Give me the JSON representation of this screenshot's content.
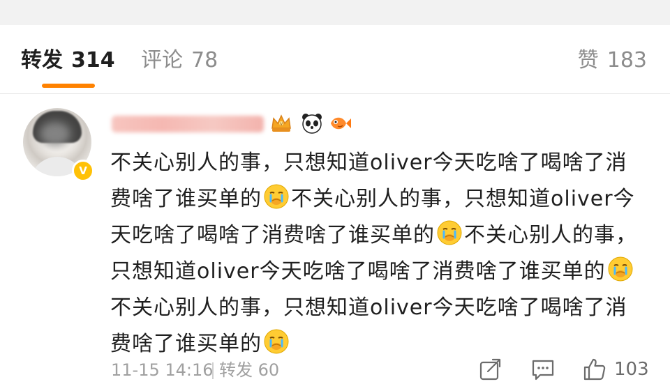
{
  "tabs": {
    "forward": {
      "label": "转发",
      "count": "314"
    },
    "comment": {
      "label": "评论",
      "count": "78"
    },
    "like": {
      "label": "赞",
      "count": "183"
    }
  },
  "comment": {
    "text_segments": [
      "不关心别人的事，只想知道oliver今天吃啥了喝啥了消费啥了谁买单的",
      "不关心别人的事，只想知道oliver今天吃啥了喝啥了消费啥了谁买单的",
      "不关心别人的事，只想知道oliver今天吃啥了喝啥了消费啥了谁买单的",
      "不关心别人的事，只想知道oliver今天吃啥了喝啥了消费啥了谁买单的"
    ],
    "timestamp": "11-15 14:16",
    "forward_label": "转发 60",
    "like_count": "103"
  },
  "colors": {
    "accent": "#ff8200",
    "verified": "#ffc107",
    "muted_text": "#a0a0a0"
  },
  "icons": {
    "verify": "verified-badge-icon",
    "share": "share-icon",
    "comment": "comment-icon",
    "like": "thumbs-up-icon",
    "emoji": "crying-emoji-icon"
  }
}
